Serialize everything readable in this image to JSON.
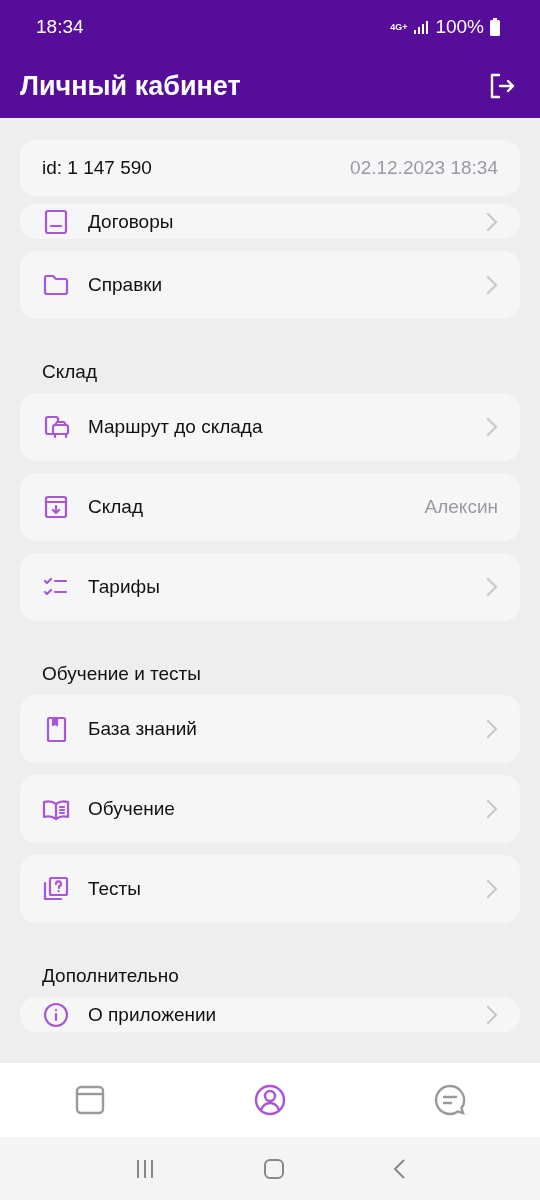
{
  "status_bar": {
    "time": "18:34",
    "network": "4G+",
    "battery": "100%"
  },
  "header": {
    "title": "Личный кабинет"
  },
  "account": {
    "id": "id: 1 147 590",
    "datetime": "02.12.2023 18:34"
  },
  "sections": [
    {
      "items": [
        {
          "label": "Договоры",
          "kind": "link"
        },
        {
          "label": "Справки",
          "kind": "link"
        }
      ]
    },
    {
      "title": "Склад",
      "items": [
        {
          "label": "Маршрут до склада",
          "kind": "link"
        },
        {
          "label": "Склад",
          "kind": "value",
          "value": "Алексин"
        },
        {
          "label": "Тарифы",
          "kind": "link"
        }
      ]
    },
    {
      "title": "Обучение и тесты",
      "items": [
        {
          "label": "База знаний",
          "kind": "link"
        },
        {
          "label": "Обучение",
          "kind": "link"
        },
        {
          "label": "Тесты",
          "kind": "link"
        }
      ]
    },
    {
      "title": "Дополнительно",
      "items": [
        {
          "label": "О приложении",
          "kind": "link"
        }
      ]
    }
  ],
  "bottom_nav": [
    {
      "selected": false
    },
    {
      "selected": true
    },
    {
      "selected": false
    }
  ]
}
